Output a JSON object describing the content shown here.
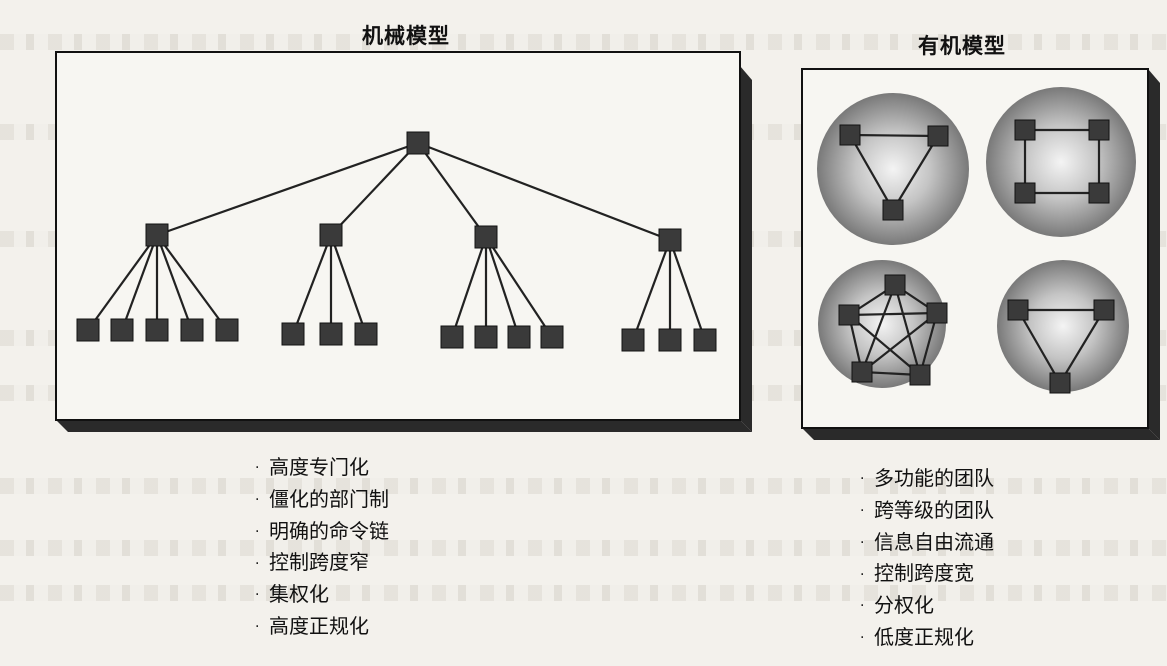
{
  "mechanistic": {
    "title": "机械模型",
    "features": [
      "高度专门化",
      "僵化的部门制",
      "明确的命令链",
      "控制跨度窄",
      "集权化",
      "高度正规化"
    ]
  },
  "organic": {
    "title": "有机模型",
    "features": [
      "多功能的团队",
      "跨等级的团队",
      "信息自由流通",
      "控制跨度宽",
      "分权化",
      "低度正规化"
    ]
  },
  "colors": {
    "node": "#3a3a3a",
    "line": "#222222",
    "box_shadow": "#2a2a2a",
    "sphere_light": "#f2f2f2",
    "sphere_dark": "#6c6c6c"
  }
}
